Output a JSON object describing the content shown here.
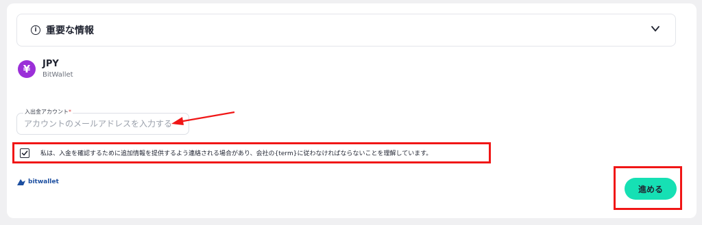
{
  "section": {
    "title": "重要な情報",
    "icon": "info-circle-icon",
    "chevron": "chevron-down-icon"
  },
  "currency": {
    "code": "JPY",
    "provider": "BitWallet",
    "symbol": "¥",
    "badge_color": "#9b2fd8"
  },
  "account_field": {
    "label": "入出金アカウント",
    "required_mark": "*",
    "placeholder": "アカウントのメールアドレスを入力する"
  },
  "consent": {
    "text": "私は、入金を確認するために追加情報を提供するよう連絡される場合があり、会社の{term}に従わなければならないことを理解しています。",
    "checked": true
  },
  "brand": {
    "name": "bitwallet",
    "color": "#1d4fa0"
  },
  "actions": {
    "proceed_label": "進める",
    "button_color": "#16e0b4"
  },
  "annotations": {
    "highlight_color": "#f01616"
  }
}
